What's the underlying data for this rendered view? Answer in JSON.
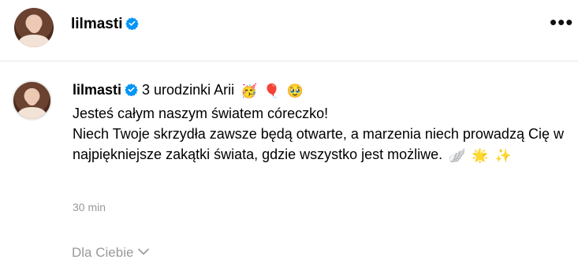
{
  "header": {
    "username": "lilmasti",
    "more_label": "•••"
  },
  "post": {
    "username": "lilmasti",
    "title": "3 urodzinki Arii",
    "title_emojis": [
      "🥳",
      "🎈",
      "🥹"
    ],
    "lines": [
      "Jesteś całym naszym światem córeczko!",
      "Niech Twoje skrzydła zawsze będą otwarte, a marzenia niech prowadzą Cię w najpiękniejsze zakątki świata, gdzie wszystko jest możliwe."
    ],
    "line_emojis": [
      "🪽",
      "🌟",
      "✨"
    ],
    "time": "30 min"
  },
  "feed_filter": {
    "label": "Dla Ciebie"
  },
  "icons": {
    "verified": "verified-badge-icon",
    "more": "more-dots-icon",
    "chevron": "chevron-down-icon"
  },
  "colors": {
    "verified": "#0095f6",
    "muted": "#999999",
    "divider": "#e6e6e6"
  }
}
